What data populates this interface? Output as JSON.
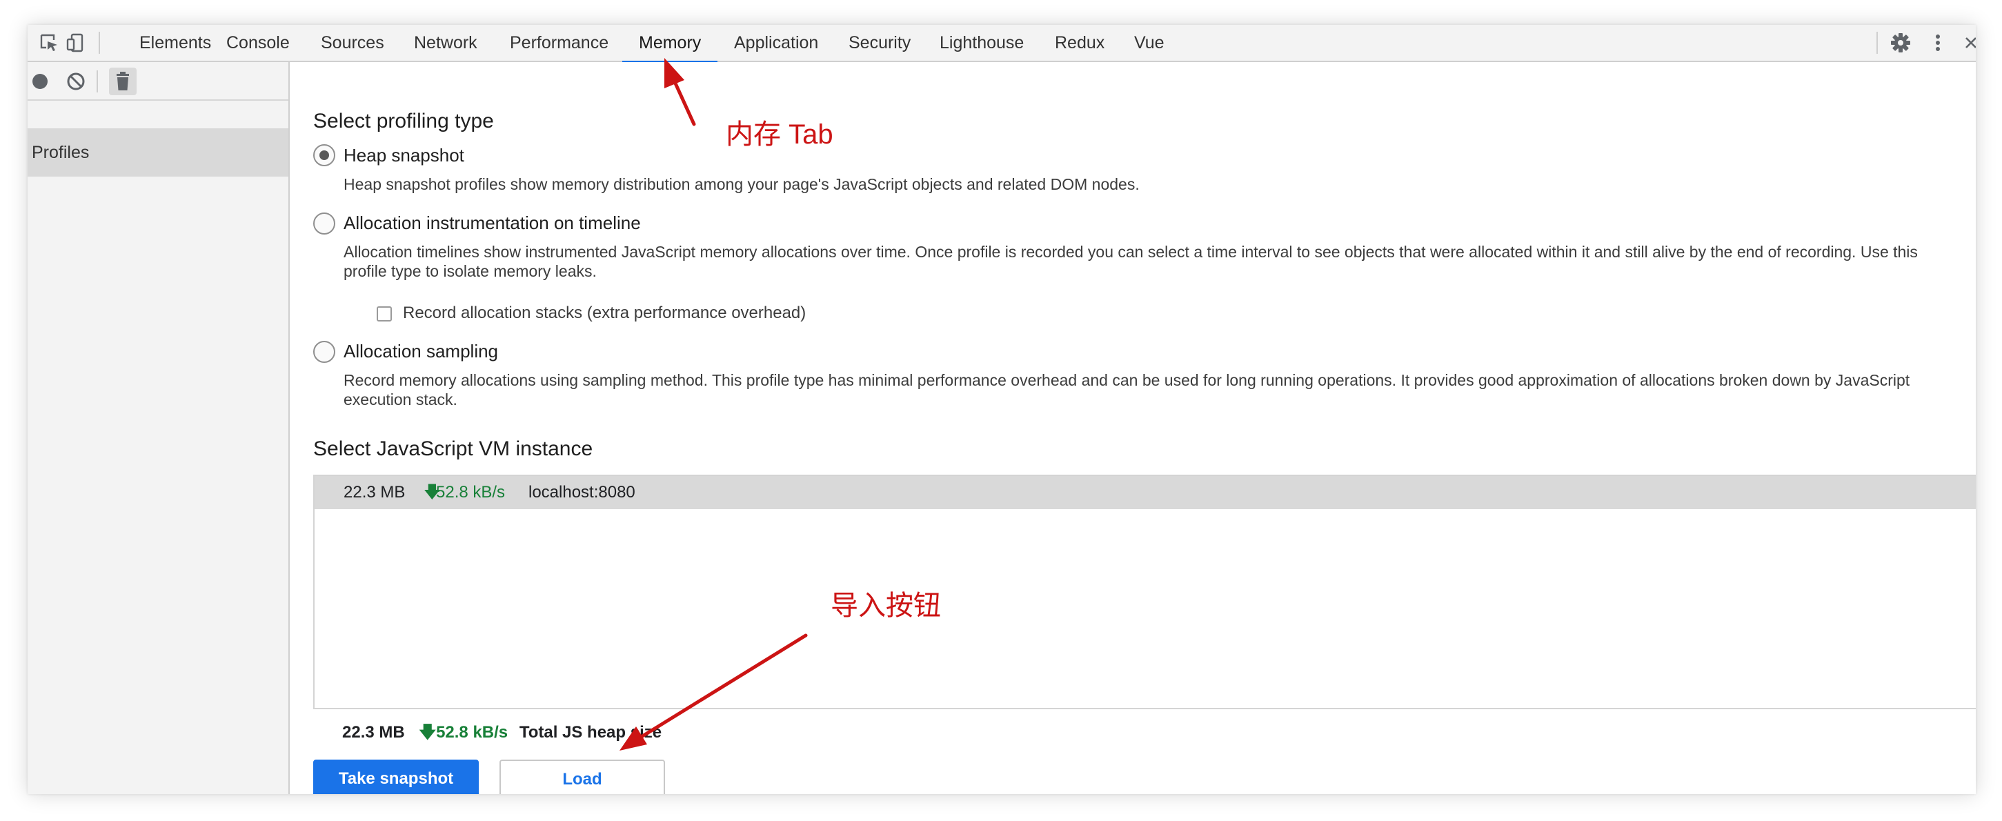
{
  "tabs": [
    {
      "label": "Elements"
    },
    {
      "label": "Console"
    },
    {
      "label": "Sources"
    },
    {
      "label": "Network"
    },
    {
      "label": "Performance"
    },
    {
      "label": "Memory",
      "active": true
    },
    {
      "label": "Application"
    },
    {
      "label": "Security"
    },
    {
      "label": "Lighthouse"
    },
    {
      "label": "Redux"
    },
    {
      "label": "Vue"
    }
  ],
  "toolbar_icons": [
    "inspect-element-icon",
    "device-toggle-icon",
    "settings-gear-icon",
    "more-vertical-icon"
  ],
  "sidebar": {
    "icons": [
      "record-icon",
      "clear-icon",
      "trash-icon"
    ],
    "profiles_label": "Profiles"
  },
  "main": {
    "profiling_heading": "Select profiling type",
    "options": [
      {
        "label": "Heap snapshot",
        "checked": true,
        "description": "Heap snapshot profiles show memory distribution among your page's JavaScript objects and related DOM nodes."
      },
      {
        "label": "Allocation instrumentation on timeline",
        "checked": false,
        "description": "Allocation timelines show instrumented JavaScript memory allocations over time. Once profile is recorded you can select a time interval to see objects that were allocated within it and still alive by the end of recording. Use this profile type to isolate memory leaks."
      },
      {
        "label": "Allocation sampling",
        "checked": false,
        "description": "Record memory allocations using sampling method. This profile type has minimal performance overhead and can be used for long running operations. It provides good approximation of allocations broken down by JavaScript execution stack."
      }
    ],
    "record_stacks_label": "Record allocation stacks (extra performance overhead)",
    "record_stacks_checked": false,
    "vm_heading": "Select JavaScript VM instance",
    "vm_instance": {
      "size": "22.3 MB",
      "rate": "52.8 kB/s",
      "host": "localhost:8080"
    },
    "heap_summary": {
      "size": "22.3 MB",
      "rate": "52.8 kB/s",
      "label": "Total JS heap size"
    },
    "buttons": {
      "take_snapshot": "Take snapshot",
      "load": "Load"
    }
  },
  "annotations": {
    "memory_tab": "内存 Tab",
    "load_button": "导入按钮"
  },
  "colors": {
    "accent": "#1a73e8",
    "annotation": "#cc1414",
    "rate_green": "#188038"
  }
}
